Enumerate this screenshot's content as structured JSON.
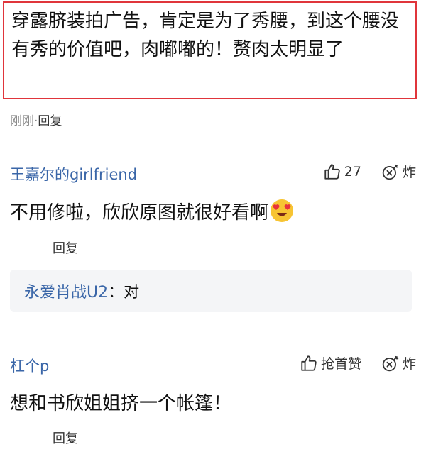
{
  "highlighted_comment": {
    "text": "穿露脐装拍广告，肯定是为了秀腰，到这个腰没有秀的价值吧，肉嘟嘟的！赘肉太明显了",
    "time": "刚刚",
    "separator": "·",
    "reply_label": "回复"
  },
  "comments": [
    {
      "user": "王嘉尔的girlfriend",
      "like_count": "27",
      "bomb_label": "炸",
      "text": "不用修啦，欣欣原图就很好看啊",
      "emoji": "heart-eyes-emoji",
      "reply_label": "回复",
      "sub_reply": {
        "user": "永爱肖战U2",
        "colon": "：",
        "text": "对"
      }
    },
    {
      "user": "杠个p",
      "like_label": "抢首赞",
      "bomb_label": "炸",
      "text": "想和书欣姐姐挤一个帐篷！",
      "reply_label": "回复"
    }
  ],
  "colors": {
    "highlight_border": "#e0353b",
    "username": "#3a66a8",
    "subreply_bg": "#f4f5f7"
  }
}
